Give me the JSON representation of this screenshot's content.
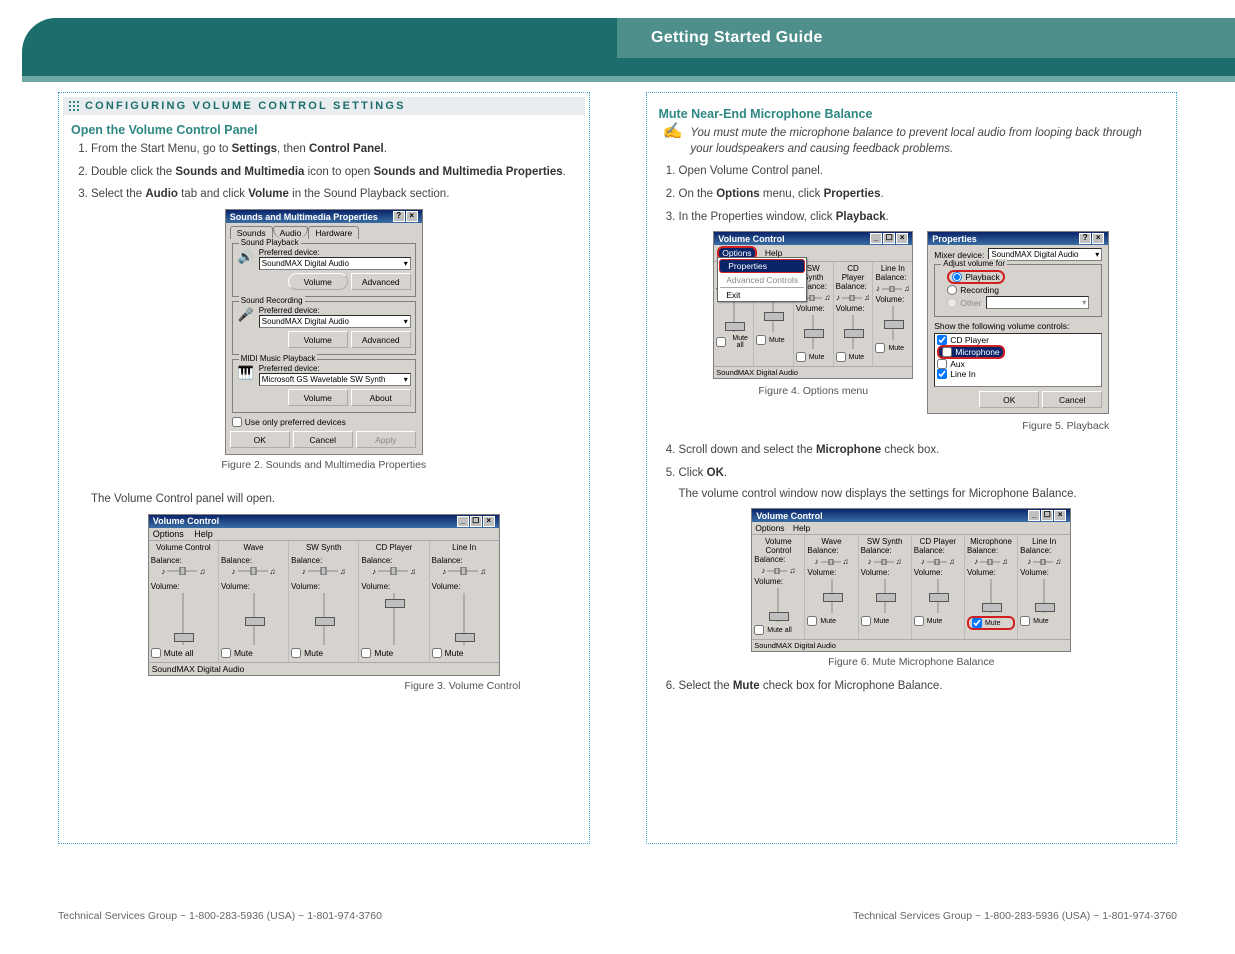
{
  "banner": {
    "title": "Getting Started Guide"
  },
  "left": {
    "section_title": "CONFIGURING VOLUME CONTROL SETTINGS",
    "sub1": "Open the Volume Control Panel",
    "step1a": "From the Start Menu, go to ",
    "step1b": "Settings",
    "step1c": ", then ",
    "step1d": "Control Panel",
    "step1e": ".",
    "step2a": "Double click the ",
    "step2b": "Sounds and Multimedia",
    "step2c": " icon to open ",
    "step2d": "Sounds and Multimedia Properties",
    "step2e": ".",
    "step3a": "Select the ",
    "step3b": "Audio",
    "step3c": " tab and click ",
    "step3d": "Volume",
    "step3e": " in the Sound Playback section.",
    "fig2_cap": "Figure 2. Sounds and Multimedia Properties",
    "body_after_fig2": "The Volume Control panel will open.",
    "fig3_cap": "Figure 3. Volume Control"
  },
  "right": {
    "sub1": "Mute Near-End Microphone Balance",
    "note": "You must mute the microphone balance to prevent local audio from looping back through your loudspeakers and causing feedback problems.",
    "step1": "Open Volume Control panel.",
    "step2a": "On the ",
    "step2b": "Options",
    "step2c": " menu, click ",
    "step2d": "Properties",
    "step2e": ".",
    "step3a": "In the Properties window, click ",
    "step3b": "Playback",
    "step3c": ".",
    "fig4_cap": "Figure 4. Options menu",
    "fig5_cap": "Figure 5. Playback",
    "step4a": "Scroll down and select the ",
    "step4b": "Microphone",
    "step4c": " check box.",
    "step5a": "Click ",
    "step5b": "OK",
    "step5c": ".",
    "body_after_ok": "The volume control window now displays the settings for Microphone Balance.",
    "fig6_cap": "Figure 6. Mute Microphone Balance",
    "step6a": "Select the ",
    "step6b": "Mute",
    "step6c": " check box for Microphone Balance."
  },
  "win_props": {
    "title": "Sounds and Multimedia Properties",
    "tab_sounds": "Sounds",
    "tab_audio": "Audio",
    "tab_hw": "Hardware",
    "grp_play": "Sound Playback",
    "grp_rec": "Sound Recording",
    "grp_midi": "MIDI Music Playback",
    "pref": "Preferred device:",
    "dev1": "SoundMAX Digital Audio",
    "dev2": "SoundMAX Digital Audio",
    "dev3": "Microsoft GS Wavetable SW Synth",
    "btn_vol": "Volume",
    "btn_adv": "Advanced",
    "btn_about": "About",
    "chk_pref": "Use only preferred devices",
    "btn_ok": "OK",
    "btn_cancel": "Cancel",
    "btn_apply": "Apply"
  },
  "win_vc_big": {
    "title": "Volume Control",
    "menu_opts": "Options",
    "menu_help": "Help",
    "labels": [
      "Volume Control",
      "Wave",
      "SW Synth",
      "CD Player",
      "Line In"
    ],
    "balance": "Balance:",
    "volume": "Volume:",
    "mute_all": "Mute all",
    "mute": "Mute",
    "status": "SoundMAX Digital Audio"
  },
  "win_vc_small": {
    "title": "Volume Control",
    "labels": [
      "Volume Control",
      "Wave",
      "SW Synth",
      "CD Player",
      "Line In"
    ],
    "balance": "Balance:",
    "volume": "Volume:",
    "mute_all": "Mute all",
    "mute": "Mute",
    "status": "SoundMAX Digital Audio",
    "menu_opts": "Options",
    "menu_help": "Help",
    "mi_props": "Properties",
    "mi_adv": "Advanced Controls",
    "mi_exit": "Exit"
  },
  "win_playback": {
    "title": "Properties",
    "mixer_lbl": "Mixer device:",
    "mixer_val": "SoundMAX Digital Audio",
    "adj_legend": "Adjust volume for",
    "opt_play": "Playback",
    "opt_rec": "Recording",
    "opt_other": "Other",
    "show_lbl": "Show the following volume controls:",
    "items": [
      "CD Player",
      "Microphone",
      "Aux",
      "Line In"
    ],
    "btn_ok": "OK",
    "btn_cancel": "Cancel"
  },
  "win_vc_mic": {
    "title": "Volume Control",
    "menu_opts": "Options",
    "menu_help": "Help",
    "labels": [
      "Volume Control",
      "Wave",
      "SW Synth",
      "CD Player",
      "Microphone",
      "Line In"
    ],
    "balance": "Balance:",
    "volume": "Volume:",
    "mute_all": "Mute all",
    "mute": "Mute",
    "status": "SoundMAX Digital Audio"
  },
  "footer": {
    "left": "Technical Services Group ~ 1-800-283-5936 (USA) ~ 1-801-974-3760",
    "right": "Technical Services Group ~ 1-800-283-5936 (USA) ~ 1-801-974-3760"
  }
}
